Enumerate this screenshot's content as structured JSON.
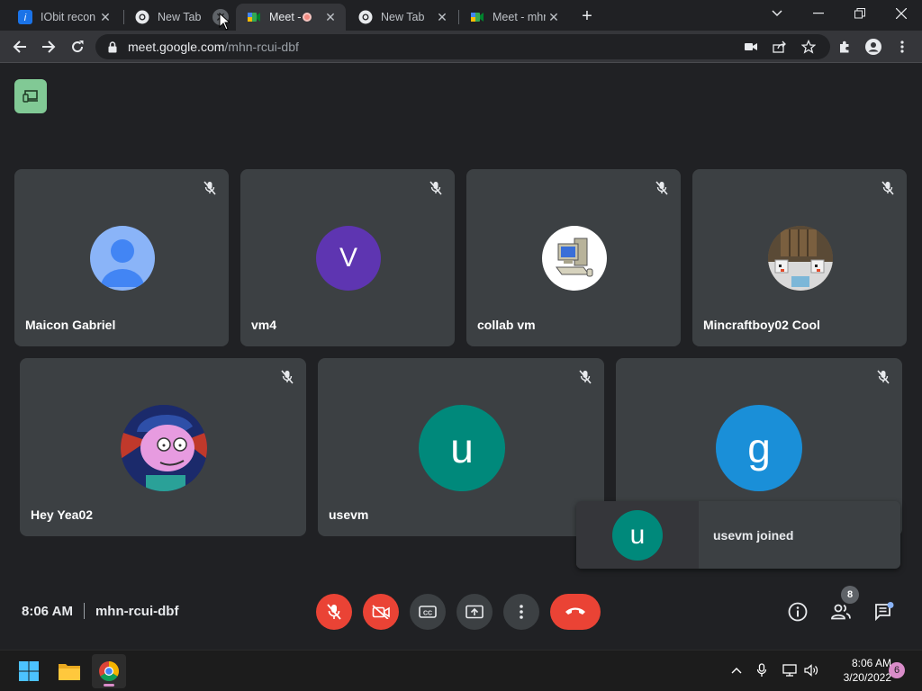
{
  "browser": {
    "tabs": [
      {
        "title": "IObit recon",
        "favicon": "iobit-icon"
      },
      {
        "title": "New Tab",
        "favicon": "chrome-icon"
      },
      {
        "title": "Meet -",
        "favicon": "meet-icon",
        "recording": true,
        "active": true
      },
      {
        "title": "New Tab",
        "favicon": "chrome-icon"
      },
      {
        "title": "Meet - mhr",
        "favicon": "meet-icon"
      }
    ],
    "url": {
      "host": "meet.google.com",
      "path": "/mhn-rcui-dbf"
    }
  },
  "meet": {
    "participants": [
      {
        "name": "Maicon Gabriel",
        "avatar": "default-person",
        "color": "#8ab4f8"
      },
      {
        "name": "vm4",
        "initial": "V",
        "color": "#5e35b1"
      },
      {
        "name": "collab vm",
        "avatar": "computer-picture"
      },
      {
        "name": "Mincraftboy02 Cool",
        "avatar": "minecraft-picture"
      },
      {
        "name": "Hey Yea02",
        "avatar": "cartoon-picture"
      },
      {
        "name": "usevm",
        "initial": "u",
        "color": "#00897b"
      },
      {
        "name": "",
        "initial": "g",
        "color": "#1a8fd8"
      }
    ],
    "toast": {
      "initial": "u",
      "message": "usevm joined"
    },
    "time": "8:06 AM",
    "code": "mhn-rcui-dbf",
    "people_count": "8"
  },
  "taskbar": {
    "time": "8:06 AM",
    "date": "3/20/2022",
    "notifications": "6"
  }
}
